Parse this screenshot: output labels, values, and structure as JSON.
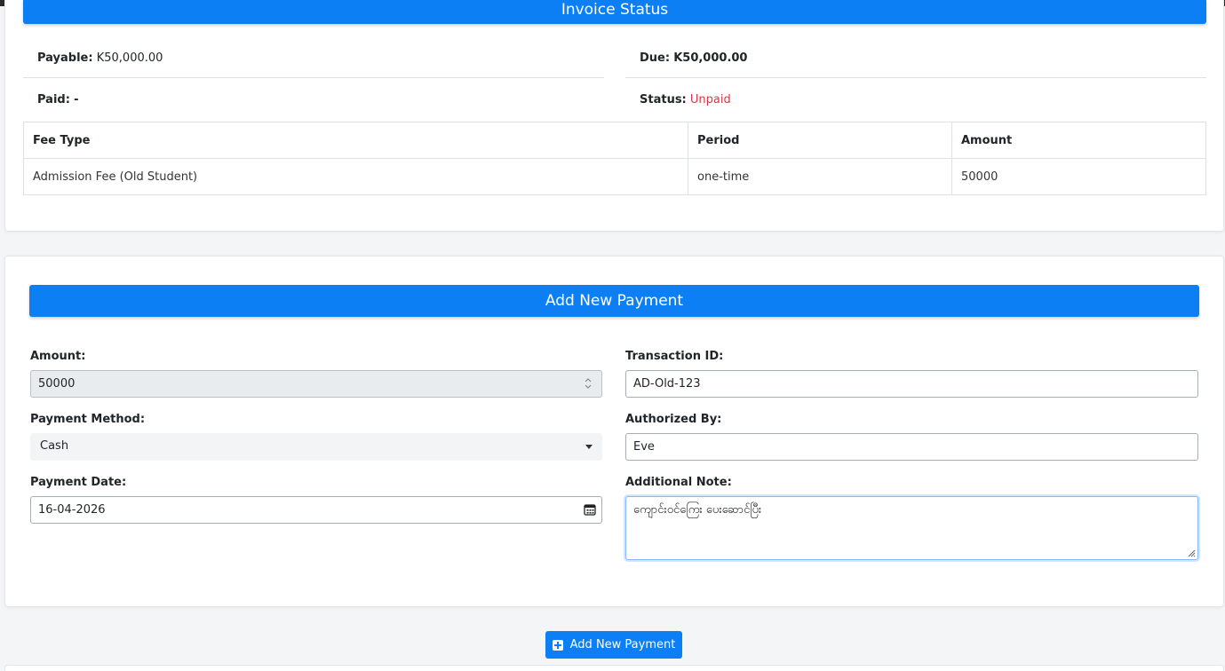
{
  "invoice": {
    "title": "Invoice Status",
    "payable_label": "Payable:",
    "payable_value": "K50,000.00",
    "due_label": "Due:",
    "due_value": "K50,000.00",
    "paid_label": "Paid:",
    "paid_value": "-",
    "status_label": "Status:",
    "status_value": "Unpaid",
    "table": {
      "headers": [
        "Fee Type",
        "Period",
        "Amount"
      ],
      "rows": [
        [
          "Admission Fee (Old Student)",
          "one-time",
          "50000"
        ]
      ]
    }
  },
  "payment_form": {
    "title": "Add New Payment",
    "amount_label": "Amount:",
    "amount_value": "50000",
    "transaction_label": "Transaction ID:",
    "transaction_value": "AD-Old-123",
    "method_label": "Payment Method:",
    "method_value": "Cash",
    "authorized_label": "Authorized By:",
    "authorized_value": "Eve",
    "date_label": "Payment Date:",
    "date_value": "16-04-2026",
    "note_label": "Additional Note:",
    "note_value": "ကျောင်းဝင်ကြေး ပေးဆောင်ပြီး"
  },
  "actions": {
    "add_payment_label": "Add New Payment"
  },
  "colors": {
    "primary": "#0d7ff5",
    "danger": "#dc3545"
  }
}
